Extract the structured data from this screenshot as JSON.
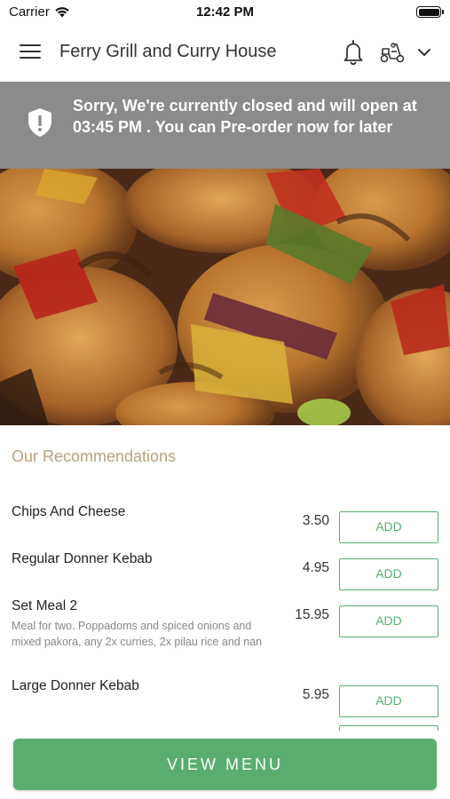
{
  "status_bar": {
    "carrier": "Carrier",
    "time": "12:42 PM"
  },
  "header": {
    "title": "Ferry Grill and Curry House",
    "icons": [
      "menu-icon",
      "bell-icon",
      "scooter-icon",
      "chevron-down-icon"
    ]
  },
  "banner": {
    "icon": "shield-exclamation-icon",
    "message": "Sorry, We're currently closed and will open at 03:45 PM . You can Pre-order now for later",
    "background": "#8b8b8b"
  },
  "recommendations": {
    "title": "Our Recommendations",
    "items": [
      {
        "name": "Chips And Cheese",
        "description": "",
        "price": "3.50",
        "button": "ADD"
      },
      {
        "name": "Regular Donner Kebab",
        "description": "",
        "price": "4.95",
        "button": "ADD"
      },
      {
        "name": "Set Meal 2",
        "description": "Meal for two. Poppadoms and spiced onions and mixed pakora, any 2x curries, 2x pilau rice and nan",
        "price": "15.95",
        "button": "ADD"
      },
      {
        "name": "Large Donner Kebab",
        "description": "",
        "price": "5.95",
        "button": "ADD"
      }
    ]
  },
  "footer": {
    "view_menu_label": "VIEW MENU"
  },
  "colors": {
    "accent_green": "#5aad70",
    "section_title": "#b8a27f"
  }
}
